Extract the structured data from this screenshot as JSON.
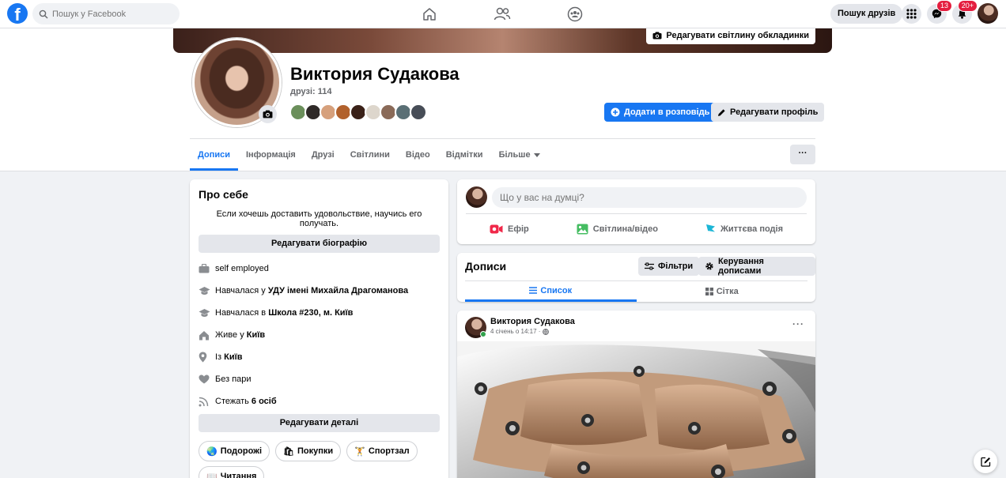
{
  "topbar": {
    "logo_letter": "f",
    "search_placeholder": "Пошук у Facebook",
    "find_friends_label": "Пошук друзів",
    "messenger_badge": "13",
    "notifications_badge": "20+"
  },
  "header": {
    "edit_cover_label": "Редагувати світлину обкладинки",
    "name": "Виктория Судакова",
    "friends_count": "друзі: 114",
    "add_story_label": "Додати в розповідь",
    "edit_profile_label": "Редагувати профіль",
    "more_label": "···"
  },
  "tabs": [
    {
      "label": "Дописи"
    },
    {
      "label": "Інформація"
    },
    {
      "label": "Друзі"
    },
    {
      "label": "Світлини"
    },
    {
      "label": "Відео"
    },
    {
      "label": "Відмітки"
    },
    {
      "label": "Більше"
    }
  ],
  "about": {
    "title": "Про себе",
    "bio": "Если хочешь доставить удовольствие, научись его получать.",
    "edit_bio_label": "Редагувати біографію",
    "details": [
      {
        "icon": "briefcase-icon",
        "prefix": "self employed",
        "bold": ""
      },
      {
        "icon": "graduation-cap-icon",
        "prefix": "Навчалася у ",
        "bold": "УДУ імені Михайла Драгоманова"
      },
      {
        "icon": "graduation-cap-icon",
        "prefix": "Навчалася в ",
        "bold": "Школа #230, м. Київ"
      },
      {
        "icon": "home-icon",
        "prefix": "Живе у ",
        "bold": "Київ"
      },
      {
        "icon": "location-pin-icon",
        "prefix": "Із ",
        "bold": "Київ"
      },
      {
        "icon": "heart-icon",
        "prefix": "Без пари",
        "bold": ""
      },
      {
        "icon": "rss-icon",
        "prefix": "Стежать ",
        "bold": "6 осіб"
      }
    ],
    "edit_details_label": "Редагувати деталі",
    "hobbies": [
      {
        "emoji": "🌏",
        "label": "Подорожі"
      },
      {
        "emoji": "🛍",
        "label": "Покупки"
      },
      {
        "emoji": "🏋",
        "label": "Спортзал"
      },
      {
        "emoji": "📖",
        "label": "Читання"
      }
    ]
  },
  "composer": {
    "placeholder": "Що у вас на думці?",
    "live_label": "Ефір",
    "photo_label": "Світлина/відео",
    "event_label": "Життєва подія"
  },
  "posts": {
    "title": "Дописи",
    "filters_label": "Фільтри",
    "manage_label": "Керування дописами",
    "list_label": "Список",
    "grid_label": "Сітка"
  },
  "post": {
    "author": "Виктория Судакова",
    "time": "4 січень о 14:17 ·",
    "more": "···"
  },
  "colors": {
    "brand": "#1877f2",
    "background": "#f0f2f5",
    "badge": "#e41e3f",
    "online": "#31a24c"
  }
}
